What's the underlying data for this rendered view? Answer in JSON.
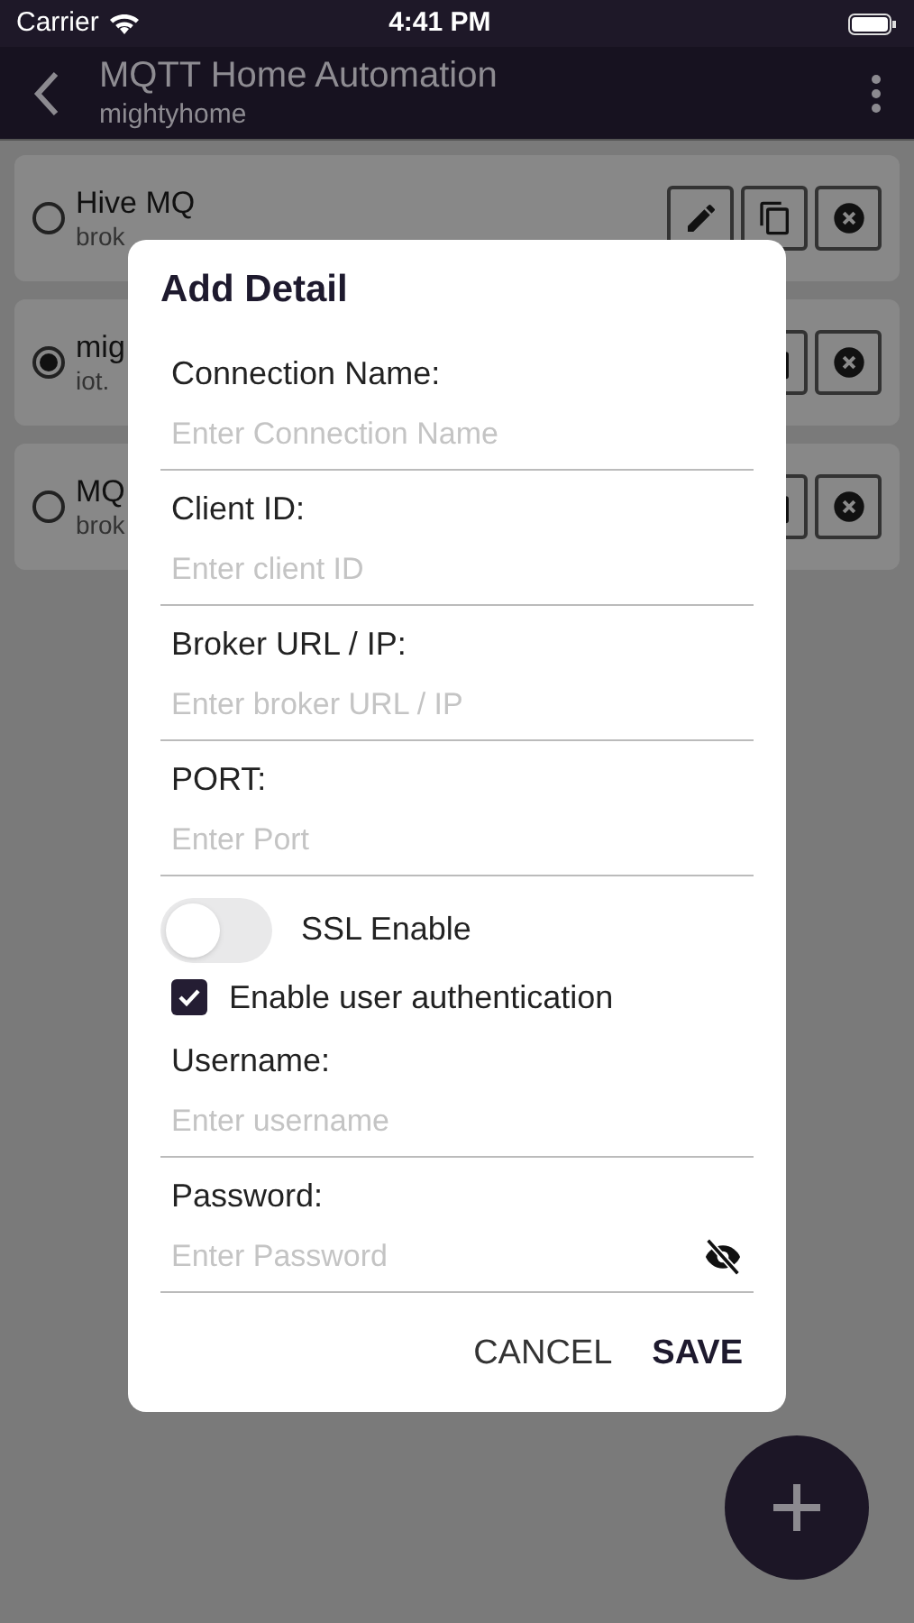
{
  "status_bar": {
    "carrier": "Carrier",
    "time": "4:41 PM"
  },
  "app_bar": {
    "title": "MQTT Home Automation",
    "subtitle": "mightyhome"
  },
  "connections": [
    {
      "name": "Hive MQ",
      "address": "brok",
      "selected": false,
      "actions": [
        {
          "kind": "edit"
        },
        {
          "kind": "copy"
        },
        {
          "kind": "delete"
        }
      ]
    },
    {
      "name": "mig",
      "address": "iot.",
      "selected": true,
      "actions": [
        {
          "kind": "copy"
        },
        {
          "kind": "delete"
        }
      ]
    },
    {
      "name": "MQ",
      "address": "brok",
      "selected": false,
      "actions": [
        {
          "kind": "copy"
        },
        {
          "kind": "delete"
        }
      ]
    }
  ],
  "dialog": {
    "title": "Add Detail",
    "items": [
      {
        "kind": "field",
        "label": "Connection Name:",
        "placeholder": "Enter Connection Name"
      },
      {
        "kind": "field",
        "label": "Client ID:",
        "placeholder": "Enter client ID"
      },
      {
        "kind": "field",
        "label": "Broker URL / IP:",
        "placeholder": "Enter broker URL / IP"
      },
      {
        "kind": "field",
        "label": "PORT:",
        "placeholder": "Enter Port"
      },
      {
        "kind": "toggle",
        "label": "SSL Enable",
        "on": false
      },
      {
        "kind": "checkbox",
        "label": "Enable user authentication",
        "checked": true
      },
      {
        "kind": "field",
        "label": "Username:",
        "placeholder": "Enter username"
      },
      {
        "kind": "password",
        "label": "Password:",
        "placeholder": "Enter Password"
      }
    ],
    "buttons": [
      {
        "label": "CANCEL",
        "kind": "secondary"
      },
      {
        "label": "SAVE",
        "kind": "primary"
      }
    ]
  }
}
